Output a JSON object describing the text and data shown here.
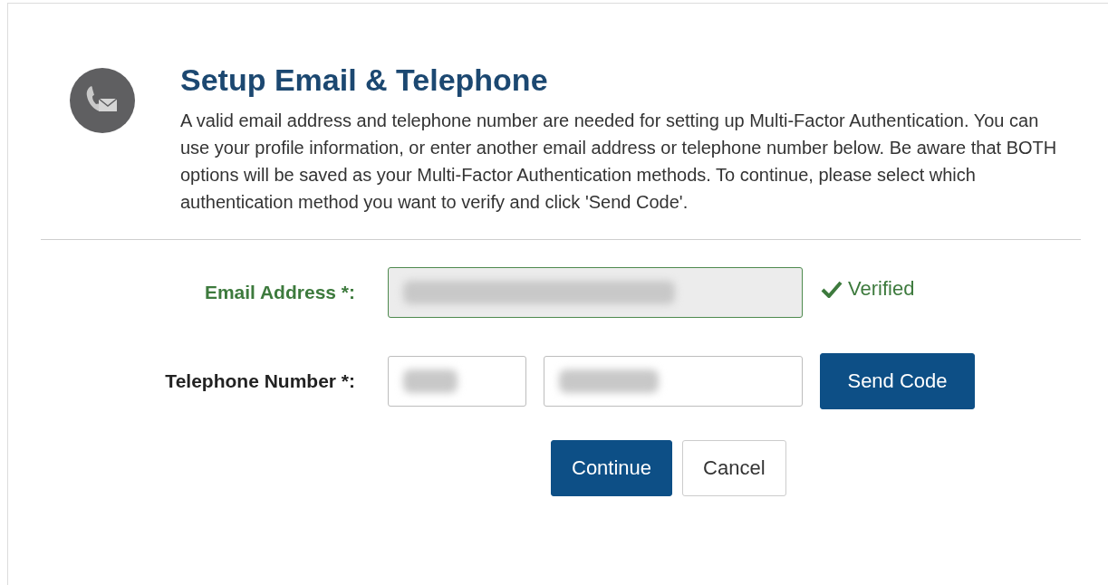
{
  "header": {
    "title": "Setup Email & Telephone",
    "description": "A valid email address and telephone number are needed for setting up Multi-Factor Authentication. You can use your profile information, or enter another email address or telephone number below. Be aware that BOTH options will be saved as your Multi-Factor Authentication methods. To continue, please select which authentication method you want to verify and click 'Send Code'."
  },
  "email": {
    "label": "Email Address *:",
    "verified": true,
    "status": "Verified"
  },
  "telephone": {
    "label": "Telephone Number *:",
    "verified": false,
    "action": "Send Code"
  },
  "buttons": [
    {
      "label": "Continue",
      "kind": "primary"
    },
    {
      "label": "Cancel",
      "kind": "secondary"
    }
  ]
}
